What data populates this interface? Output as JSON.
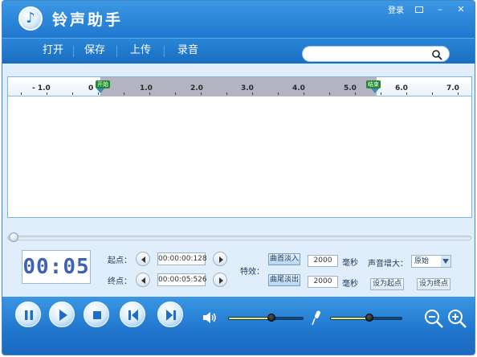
{
  "window": {
    "title": "铃声助手",
    "login_label": "登录",
    "accent": "#1f78cf"
  },
  "menu": {
    "items": [
      "打开",
      "保存",
      "上传",
      "录音"
    ]
  },
  "search": {
    "value": "",
    "placeholder": ""
  },
  "ruler": {
    "ticks": [
      "- 1.0",
      "0",
      "1.0",
      "2.0",
      "3.0",
      "4.0",
      "5.0",
      "6.0",
      "7.0"
    ],
    "start_marker": "开始",
    "end_marker": "结束"
  },
  "position": {
    "fraction": 0.0
  },
  "timer": {
    "display": "00:05"
  },
  "range": {
    "start_label": "起点：",
    "start_value": "00:00:00:128",
    "end_label": "终点：",
    "end_value": "00:00:05:526"
  },
  "effects": {
    "label": "特效：",
    "fade_in_label": "曲首淡入",
    "fade_in_value": "2000",
    "fade_out_label": "曲尾淡出",
    "fade_out_value": "2000",
    "unit": "毫秒"
  },
  "amplify": {
    "label": "声音增大：",
    "selected": "原始"
  },
  "actions": {
    "set_start": "设为起点",
    "set_end": "设为终点"
  },
  "playback": {
    "volume_level": 0.58,
    "mic_level": 0.55
  }
}
